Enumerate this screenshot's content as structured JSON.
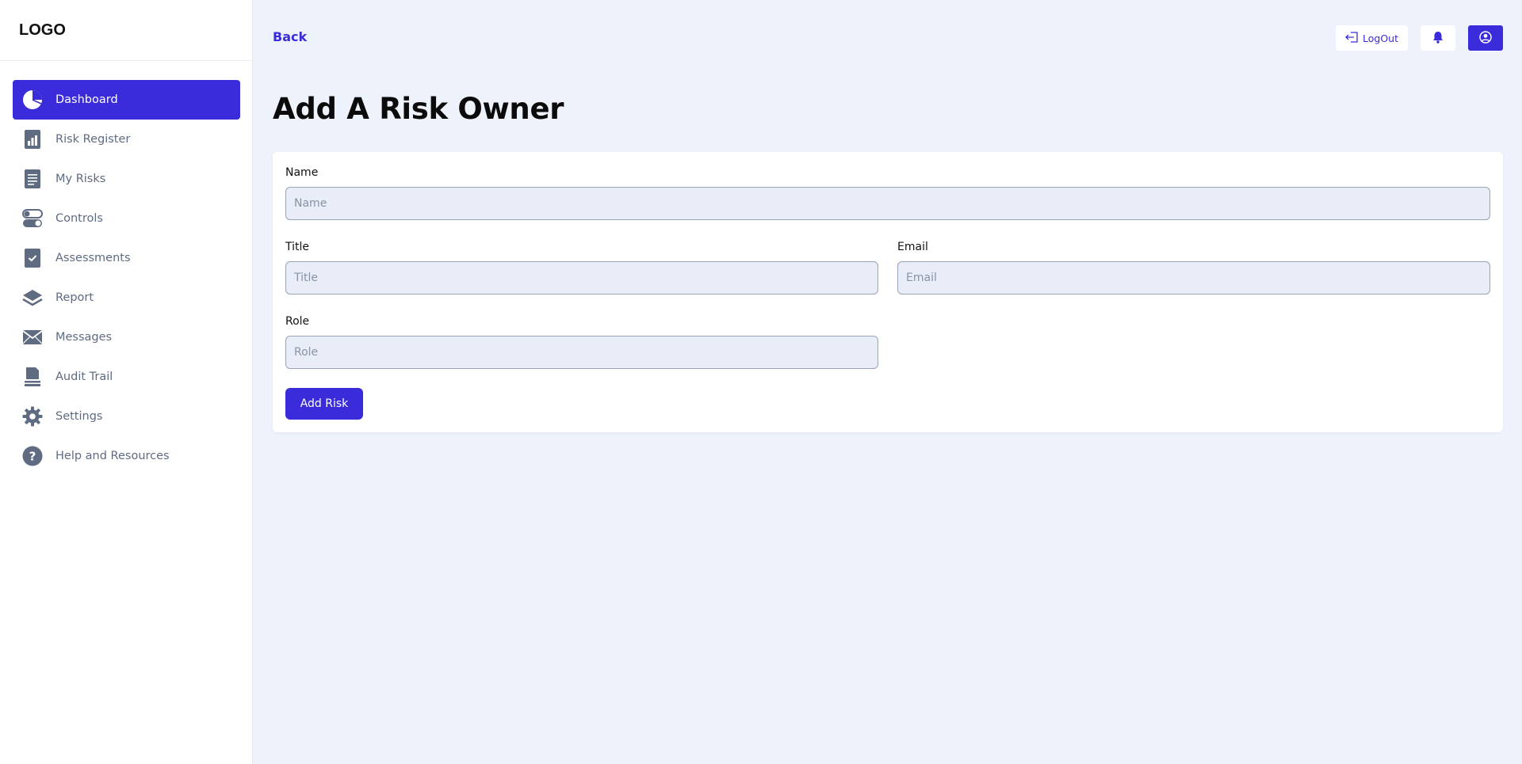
{
  "sidebar": {
    "logo": "LOGO",
    "items": [
      {
        "label": "Dashboard",
        "icon": "pie-chart-icon",
        "active": true
      },
      {
        "label": "Risk Register",
        "icon": "bar-chart-icon",
        "active": false
      },
      {
        "label": "My Risks",
        "icon": "document-icon",
        "active": false
      },
      {
        "label": "Controls",
        "icon": "toggle-icon",
        "active": false
      },
      {
        "label": "Assessments",
        "icon": "checkbox-icon",
        "active": false
      },
      {
        "label": "Report",
        "icon": "layers-icon",
        "active": false
      },
      {
        "label": "Messages",
        "icon": "envelope-icon",
        "active": false
      },
      {
        "label": "Audit Trail",
        "icon": "file-stack-icon",
        "active": false
      },
      {
        "label": "Settings",
        "icon": "gear-icon",
        "active": false
      },
      {
        "label": "Help and Resources",
        "icon": "question-icon",
        "active": false
      }
    ]
  },
  "header": {
    "back_label": "Back",
    "logout_label": "LogOut"
  },
  "page": {
    "title": "Add A Risk Owner"
  },
  "form": {
    "name": {
      "label": "Name",
      "placeholder": "Name",
      "value": ""
    },
    "title": {
      "label": "Title",
      "placeholder": "Title",
      "value": ""
    },
    "email": {
      "label": "Email",
      "placeholder": "Email",
      "value": ""
    },
    "role": {
      "label": "Role",
      "placeholder": "Role",
      "value": ""
    },
    "submit_label": "Add Risk"
  },
  "colors": {
    "accent": "#3a2bdb",
    "background": "#eef2fa",
    "sidebar_text": "#5e6b81",
    "input_bg": "#e9edf8"
  }
}
